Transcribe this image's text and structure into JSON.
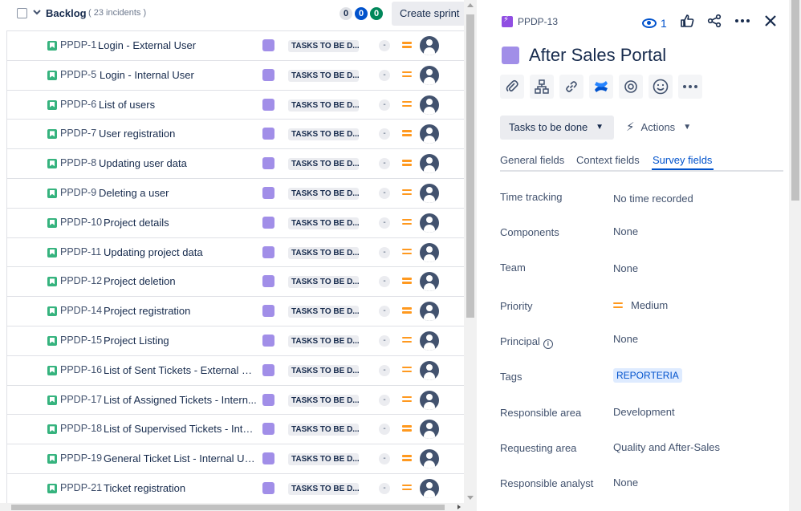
{
  "backlog": {
    "title": "Backlog",
    "count_label": "( 23 incidents )",
    "badges": [
      "0",
      "0",
      "0"
    ],
    "create_sprint_label": "Create sprint",
    "rows": [
      {
        "key": "PPDP-1",
        "summary": "Login - External User",
        "status": "TASKS TO BE D...",
        "estimate": "-"
      },
      {
        "key": "PPDP-5",
        "summary": "Login - Internal User",
        "status": "TASKS TO BE D...",
        "estimate": "-"
      },
      {
        "key": "PPDP-6",
        "summary": "List of users",
        "status": "TASKS TO BE D...",
        "estimate": "-"
      },
      {
        "key": "PPDP-7",
        "summary": "User registration",
        "status": "TASKS TO BE D...",
        "estimate": "-"
      },
      {
        "key": "PPDP-8",
        "summary": "Updating user data",
        "status": "TASKS TO BE D...",
        "estimate": "-"
      },
      {
        "key": "PPDP-9",
        "summary": "Deleting a user",
        "status": "TASKS TO BE D...",
        "estimate": "-"
      },
      {
        "key": "PPDP-10",
        "summary": "Project details",
        "status": "TASKS TO BE D...",
        "estimate": "-"
      },
      {
        "key": "PPDP-11",
        "summary": "Updating project data",
        "status": "TASKS TO BE D...",
        "estimate": "-"
      },
      {
        "key": "PPDP-12",
        "summary": "Project deletion",
        "status": "TASKS TO BE D...",
        "estimate": "-"
      },
      {
        "key": "PPDP-14",
        "summary": "Project registration",
        "status": "TASKS TO BE D...",
        "estimate": "-"
      },
      {
        "key": "PPDP-15",
        "summary": "Project Listing",
        "status": "TASKS TO BE D...",
        "estimate": "-"
      },
      {
        "key": "PPDP-16",
        "summary": "List of Sent Tickets - External Us...",
        "status": "TASKS TO BE D...",
        "estimate": "-"
      },
      {
        "key": "PPDP-17",
        "summary": "List of Assigned Tickets - Intern...",
        "status": "TASKS TO BE D...",
        "estimate": "-"
      },
      {
        "key": "PPDP-18",
        "summary": "List of Supervised Tickets - Inter...",
        "status": "TASKS TO BE D...",
        "estimate": "-"
      },
      {
        "key": "PPDP-19",
        "summary": "General Ticket List - Internal Us...",
        "status": "TASKS TO BE D...",
        "estimate": "-"
      },
      {
        "key": "PPDP-21",
        "summary": "Ticket registration",
        "status": "TASKS TO BE D...",
        "estimate": "-"
      }
    ]
  },
  "detail": {
    "issue_key": "PPDP-13",
    "watch_count": "1",
    "title": "After Sales Portal",
    "status_button": "Tasks to be done",
    "actions_button": "Actions",
    "tabs": [
      "General fields",
      "Context fields",
      "Survey fields"
    ],
    "active_tab": "Survey fields",
    "fields": [
      {
        "label": "Time tracking",
        "value": "No time recorded"
      },
      {
        "label": "Components",
        "value": "None"
      },
      {
        "label": "Team",
        "value": "None"
      },
      {
        "label": "Priority",
        "value": "Medium"
      },
      {
        "label": "Principal",
        "value": "None"
      },
      {
        "label": "Tags",
        "value": "REPORTERIA"
      },
      {
        "label": "Responsible area",
        "value": "Development"
      },
      {
        "label": "Requesting area",
        "value": "Quality and After-Sales"
      },
      {
        "label": "Responsible analyst",
        "value": "None"
      }
    ]
  },
  "colors": {
    "accent": "#0052cc",
    "epic": "#a18ee8",
    "story": "#36b37e",
    "priority_medium": "#ff991f"
  },
  "icons": [
    "chevron-down-icon",
    "story-icon",
    "epic-icon",
    "avatar-icon",
    "priority-medium-icon",
    "subtask-icon",
    "eye-icon",
    "like-icon",
    "share-icon",
    "more-icon",
    "close-icon",
    "attachment-icon",
    "child-issues-icon",
    "link-icon",
    "confluence-icon",
    "target-icon",
    "emoji-icon",
    "bolt-icon",
    "info-icon"
  ]
}
